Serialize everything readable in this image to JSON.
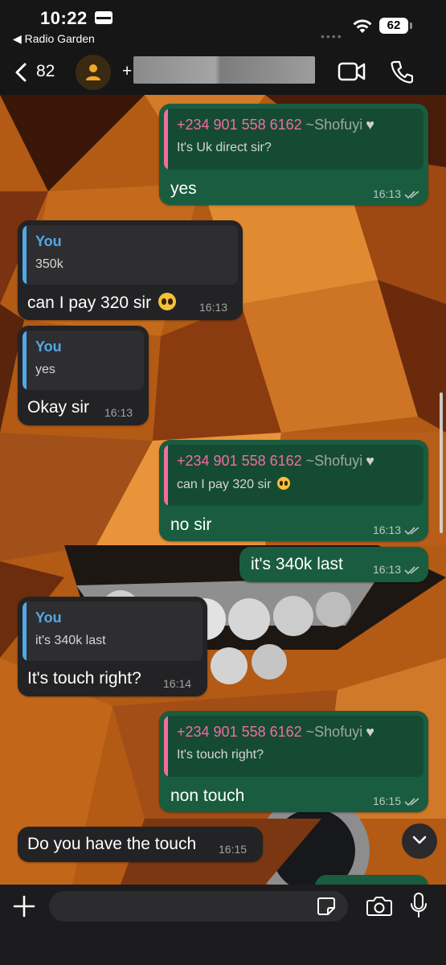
{
  "status_bar": {
    "time": "10:22",
    "back_app": "◀ Radio Garden",
    "battery": "62"
  },
  "header": {
    "back_count": "82",
    "contact_prefix": "+"
  },
  "messages": [
    {
      "dir": "out",
      "quote_author": "+234 901 558 6162",
      "quote_tag": " ~Shofuyi",
      "quote_text": "It's Uk direct sir?",
      "text": "yes",
      "time": "16:13"
    },
    {
      "dir": "in",
      "quote_author": "You",
      "quote_text": "350k",
      "text": "can I pay 320 sir",
      "time": "16:13"
    },
    {
      "dir": "in",
      "quote_author": "You",
      "quote_text": "yes",
      "text": "Okay sir",
      "time": "16:13"
    },
    {
      "dir": "out",
      "quote_author": "+234 901 558 6162",
      "quote_tag": " ~Shofuyi",
      "quote_text": "can I pay 320 sir",
      "text": "no sir",
      "time": "16:13"
    },
    {
      "dir": "out",
      "text": "it's 340k last",
      "time": "16:13"
    },
    {
      "dir": "in",
      "quote_author": "You",
      "quote_text": "it's 340k last",
      "text": "It's touch right?",
      "time": "16:14"
    },
    {
      "dir": "out",
      "quote_author": "+234 901 558 6162",
      "quote_tag": " ~Shofuyi",
      "quote_text": "It's touch right?",
      "text": "non touch",
      "time": "16:15"
    },
    {
      "dir": "in",
      "text": "Do you have the touch",
      "time": "16:15"
    }
  ],
  "icons": {
    "back": "chevron-left-icon",
    "avatar": "person-icon",
    "video": "video-camera-icon",
    "call": "phone-icon",
    "scroll_down": "chevron-down-icon",
    "attach": "plus-icon",
    "sticker": "sticker-icon",
    "camera": "camera-icon",
    "mic": "microphone-icon"
  },
  "colors": {
    "outgoing_bubble": "#1a5c3f",
    "incoming_bubble": "#232325",
    "quote_author_pink": "#f06ea1",
    "quote_author_blue": "#52a8e6",
    "wallpaper": "#b85c12"
  }
}
